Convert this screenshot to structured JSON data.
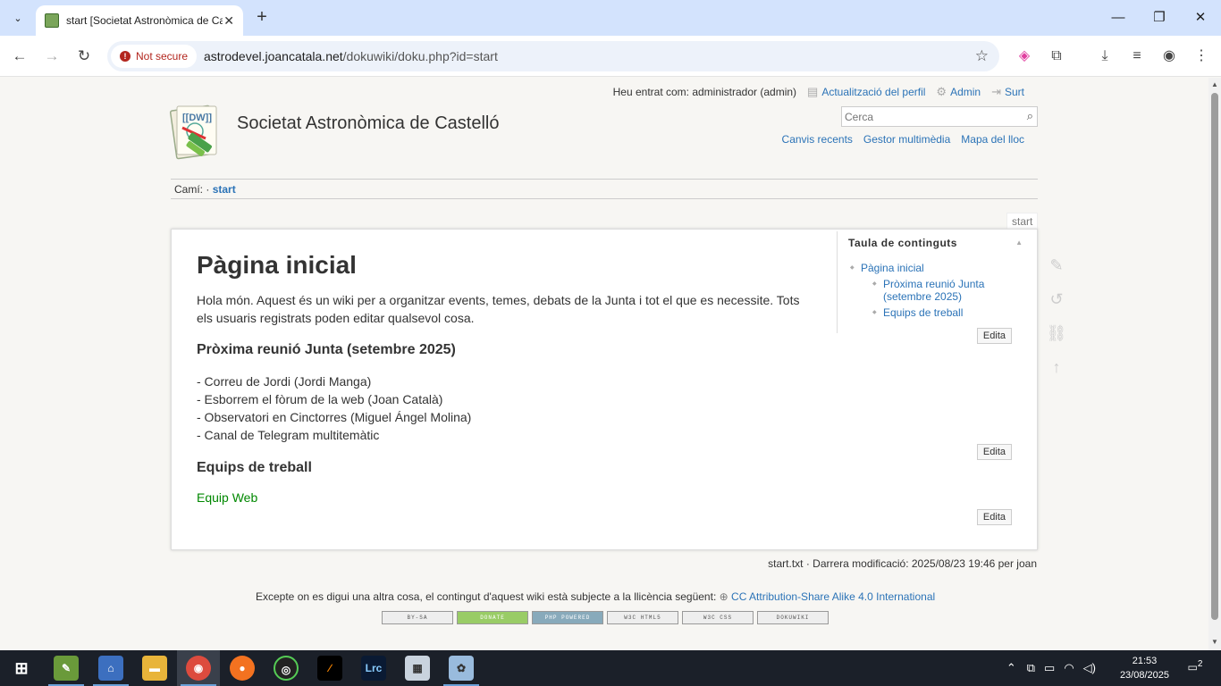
{
  "browser": {
    "tab_title": "start [Societat Astronòmica de Castelló]",
    "not_secure": "Not secure",
    "url_host": "astrodevel.joancatala.net",
    "url_path": "/dokuwiki/doku.php?id=start"
  },
  "usertools": {
    "logged_in": "Heu entrat com: administrador (admin)",
    "profile": "Actualització del perfil",
    "admin": "Admin",
    "logout": "Surt"
  },
  "site": {
    "title": "Societat Astronòmica de Castelló",
    "search_placeholder": "Cerca",
    "tools": [
      "Canvis recents",
      "Gestor multimèdia",
      "Mapa del lloc"
    ]
  },
  "breadcrumbs": {
    "label": "Camí:",
    "sep": "·",
    "current": "start"
  },
  "page": {
    "id": "start",
    "h1": "Pàgina inicial",
    "intro": "Hola món. Aquest és un wiki per a organitzar events, temes, debats de la Junta i tot el que es necessite. Tots els usuaris registrats poden editar qualsevol cosa.",
    "section1": "Pròxima reunió Junta (setembre 2025)",
    "items": [
      "- Correu de Jordi (Jordi Manga)",
      "- Esborrem el fòrum de la web (Joan Català)",
      "- Observatori en Cinctorres (Miguel Ángel Molina)",
      "- Canal de Telegram multitemàtic"
    ],
    "section2": "Equips de treball",
    "link_equip": "Equip Web",
    "edit_label": "Edita"
  },
  "toc": {
    "heading": "Taula de continguts",
    "items": [
      "Pàgina inicial",
      "Pròxima reunió Junta (setembre 2025)",
      "Equips de treball"
    ]
  },
  "footer": {
    "docinfo": "start.txt · Darrera modificació: 2025/08/23 19:46 per joan",
    "license_text": "Excepte on es digui una altra cosa, el contingut d'aquest wiki està subjecte a la llicència següent:",
    "license_link": "CC Attribution-Share Alike 4.0 International",
    "badges": [
      "BY-SA",
      "DONATE",
      "PHP POWERED",
      "W3C HTML5",
      "W3C CSS",
      "DOKUWIKI"
    ]
  },
  "taskbar": {
    "time": "21:53",
    "date": "23/08/2025",
    "notifications": "2",
    "apps": [
      "lrc-label"
    ],
    "lrc": "Lrc"
  }
}
